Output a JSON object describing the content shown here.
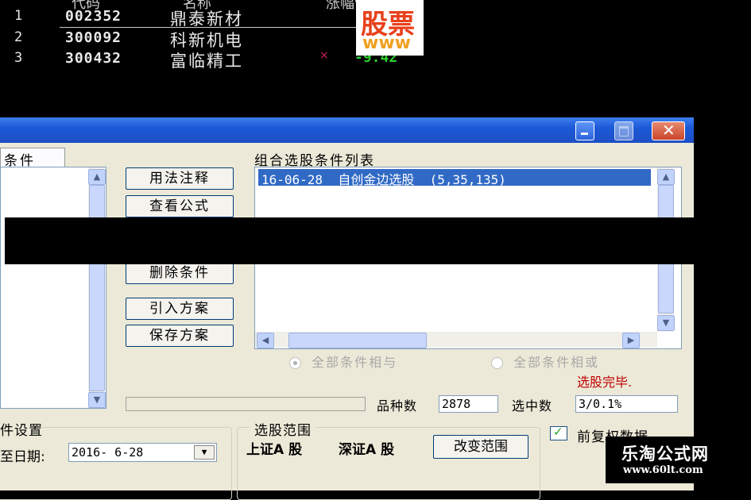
{
  "stocks": [
    {
      "idx": "1",
      "code": "002352",
      "name": "鼎泰新材",
      "change": ""
    },
    {
      "idx": "2",
      "code": "300092",
      "name": "科新机电",
      "change": ""
    },
    {
      "idx": "3",
      "code": "300432",
      "name": "富临精工",
      "change": "-9.42"
    }
  ],
  "header_cols": {
    "code": "代码",
    "name": "名称",
    "rise": "涨幅%"
  },
  "watermark_top": {
    "line1": "股票",
    "line2": "www"
  },
  "window": {
    "left_tab_label": "条件",
    "list_title": "组合选股条件列表",
    "list_items": [
      "16-06-28  自创金边选股  (5,35,135)"
    ],
    "buttons": {
      "usage": "用法注释",
      "view_formula": "查看公式",
      "delete": "删除条件",
      "import": "引入方案",
      "save": "保存方案",
      "change_range": "改变范围"
    },
    "radio_and": "全部条件相与",
    "radio_or": "全部条件相或",
    "status": "选股完毕.",
    "count_label": "品种数",
    "count_value": "2878",
    "selected_label": "选中数",
    "selected_value": "3/0.1%",
    "settings_label": "件设置",
    "date_label": "至日期:",
    "date_value": "2016- 6-28",
    "range_title": "选股范围",
    "range_sh": "上证A 股",
    "range_sz": "深证A 股",
    "checkbox_label": "前复权数据"
  },
  "watermark_bottom": {
    "line1": "乐淘公式网",
    "line2": "www.60lt.com"
  },
  "colors": {
    "title_bar": "#1d4fc5",
    "close_btn": "#d9533b",
    "selection": "#316ac5",
    "status_red": "#c00000"
  }
}
